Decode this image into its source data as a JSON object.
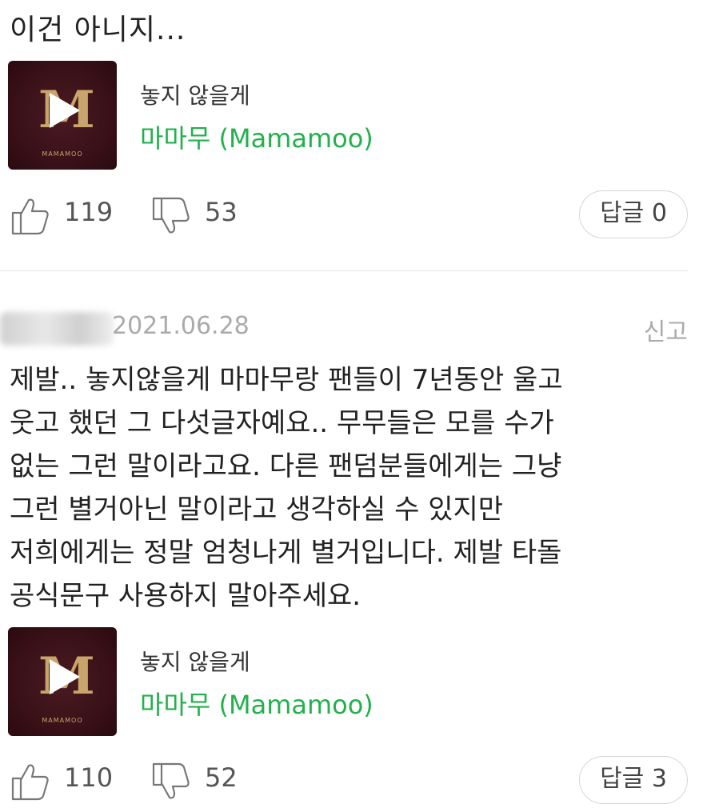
{
  "prev_comment": {
    "text_tail": "이건 아니지...",
    "song": {
      "title": "놓지 않을게",
      "artist": "마마무 (Mamamoo)",
      "album_brand": "MAMAMOO",
      "album_letter": "M"
    },
    "likes": "119",
    "dislikes": "53",
    "reply_label": "답글 0"
  },
  "comment": {
    "date": "2021.06.28",
    "report_label": "신고",
    "body_lines": [
      "제발.. 놓지않을게 마마무랑 팬들이 7년동안 울고",
      "웃고 했던 그 다섯글자예요.. 무무들은 모를 수가",
      "없는 그런 말이라고요. 다른 팬덤분들에게는 그냥",
      "그런 별거아닌 말이라고 생각하실 수 있지만",
      "저희에게는 정말 엄청나게 별거입니다. 제발 타돌",
      "공식문구 사용하지 말아주세요."
    ],
    "song": {
      "title": "놓지 않을게",
      "artist": "마마무 (Mamamoo)",
      "album_brand": "MAMAMOO",
      "album_letter": "M"
    },
    "likes": "110",
    "dislikes": "52",
    "reply_label": "답글 3"
  },
  "colors": {
    "artist_green": "#22b14c",
    "meta_gray": "#aaaaaa",
    "album_bg": "#3a1118"
  },
  "icons": {
    "like": "thumbs-up-icon",
    "dislike": "thumbs-down-icon",
    "play": "play-icon"
  }
}
